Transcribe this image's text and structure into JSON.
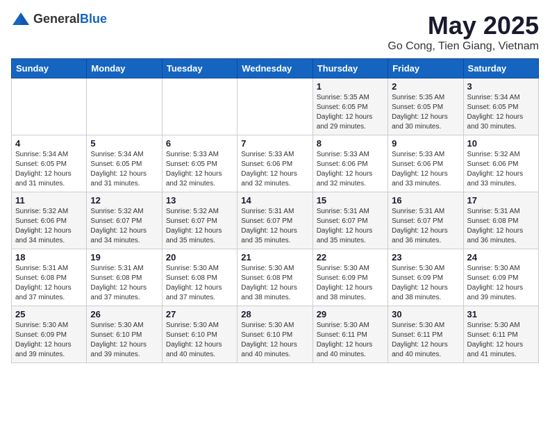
{
  "header": {
    "logo_general": "General",
    "logo_blue": "Blue",
    "title": "May 2025",
    "subtitle": "Go Cong, Tien Giang, Vietnam"
  },
  "weekdays": [
    "Sunday",
    "Monday",
    "Tuesday",
    "Wednesday",
    "Thursday",
    "Friday",
    "Saturday"
  ],
  "weeks": [
    [
      {
        "day": "",
        "content": ""
      },
      {
        "day": "",
        "content": ""
      },
      {
        "day": "",
        "content": ""
      },
      {
        "day": "",
        "content": ""
      },
      {
        "day": "1",
        "content": "Sunrise: 5:35 AM\nSunset: 6:05 PM\nDaylight: 12 hours\nand 29 minutes."
      },
      {
        "day": "2",
        "content": "Sunrise: 5:35 AM\nSunset: 6:05 PM\nDaylight: 12 hours\nand 30 minutes."
      },
      {
        "day": "3",
        "content": "Sunrise: 5:34 AM\nSunset: 6:05 PM\nDaylight: 12 hours\nand 30 minutes."
      }
    ],
    [
      {
        "day": "4",
        "content": "Sunrise: 5:34 AM\nSunset: 6:05 PM\nDaylight: 12 hours\nand 31 minutes."
      },
      {
        "day": "5",
        "content": "Sunrise: 5:34 AM\nSunset: 6:05 PM\nDaylight: 12 hours\nand 31 minutes."
      },
      {
        "day": "6",
        "content": "Sunrise: 5:33 AM\nSunset: 6:05 PM\nDaylight: 12 hours\nand 32 minutes."
      },
      {
        "day": "7",
        "content": "Sunrise: 5:33 AM\nSunset: 6:06 PM\nDaylight: 12 hours\nand 32 minutes."
      },
      {
        "day": "8",
        "content": "Sunrise: 5:33 AM\nSunset: 6:06 PM\nDaylight: 12 hours\nand 32 minutes."
      },
      {
        "day": "9",
        "content": "Sunrise: 5:33 AM\nSunset: 6:06 PM\nDaylight: 12 hours\nand 33 minutes."
      },
      {
        "day": "10",
        "content": "Sunrise: 5:32 AM\nSunset: 6:06 PM\nDaylight: 12 hours\nand 33 minutes."
      }
    ],
    [
      {
        "day": "11",
        "content": "Sunrise: 5:32 AM\nSunset: 6:06 PM\nDaylight: 12 hours\nand 34 minutes."
      },
      {
        "day": "12",
        "content": "Sunrise: 5:32 AM\nSunset: 6:07 PM\nDaylight: 12 hours\nand 34 minutes."
      },
      {
        "day": "13",
        "content": "Sunrise: 5:32 AM\nSunset: 6:07 PM\nDaylight: 12 hours\nand 35 minutes."
      },
      {
        "day": "14",
        "content": "Sunrise: 5:31 AM\nSunset: 6:07 PM\nDaylight: 12 hours\nand 35 minutes."
      },
      {
        "day": "15",
        "content": "Sunrise: 5:31 AM\nSunset: 6:07 PM\nDaylight: 12 hours\nand 35 minutes."
      },
      {
        "day": "16",
        "content": "Sunrise: 5:31 AM\nSunset: 6:07 PM\nDaylight: 12 hours\nand 36 minutes."
      },
      {
        "day": "17",
        "content": "Sunrise: 5:31 AM\nSunset: 6:08 PM\nDaylight: 12 hours\nand 36 minutes."
      }
    ],
    [
      {
        "day": "18",
        "content": "Sunrise: 5:31 AM\nSunset: 6:08 PM\nDaylight: 12 hours\nand 37 minutes."
      },
      {
        "day": "19",
        "content": "Sunrise: 5:31 AM\nSunset: 6:08 PM\nDaylight: 12 hours\nand 37 minutes."
      },
      {
        "day": "20",
        "content": "Sunrise: 5:30 AM\nSunset: 6:08 PM\nDaylight: 12 hours\nand 37 minutes."
      },
      {
        "day": "21",
        "content": "Sunrise: 5:30 AM\nSunset: 6:08 PM\nDaylight: 12 hours\nand 38 minutes."
      },
      {
        "day": "22",
        "content": "Sunrise: 5:30 AM\nSunset: 6:09 PM\nDaylight: 12 hours\nand 38 minutes."
      },
      {
        "day": "23",
        "content": "Sunrise: 5:30 AM\nSunset: 6:09 PM\nDaylight: 12 hours\nand 38 minutes."
      },
      {
        "day": "24",
        "content": "Sunrise: 5:30 AM\nSunset: 6:09 PM\nDaylight: 12 hours\nand 39 minutes."
      }
    ],
    [
      {
        "day": "25",
        "content": "Sunrise: 5:30 AM\nSunset: 6:09 PM\nDaylight: 12 hours\nand 39 minutes."
      },
      {
        "day": "26",
        "content": "Sunrise: 5:30 AM\nSunset: 6:10 PM\nDaylight: 12 hours\nand 39 minutes."
      },
      {
        "day": "27",
        "content": "Sunrise: 5:30 AM\nSunset: 6:10 PM\nDaylight: 12 hours\nand 40 minutes."
      },
      {
        "day": "28",
        "content": "Sunrise: 5:30 AM\nSunset: 6:10 PM\nDaylight: 12 hours\nand 40 minutes."
      },
      {
        "day": "29",
        "content": "Sunrise: 5:30 AM\nSunset: 6:11 PM\nDaylight: 12 hours\nand 40 minutes."
      },
      {
        "day": "30",
        "content": "Sunrise: 5:30 AM\nSunset: 6:11 PM\nDaylight: 12 hours\nand 40 minutes."
      },
      {
        "day": "31",
        "content": "Sunrise: 5:30 AM\nSunset: 6:11 PM\nDaylight: 12 hours\nand 41 minutes."
      }
    ]
  ]
}
